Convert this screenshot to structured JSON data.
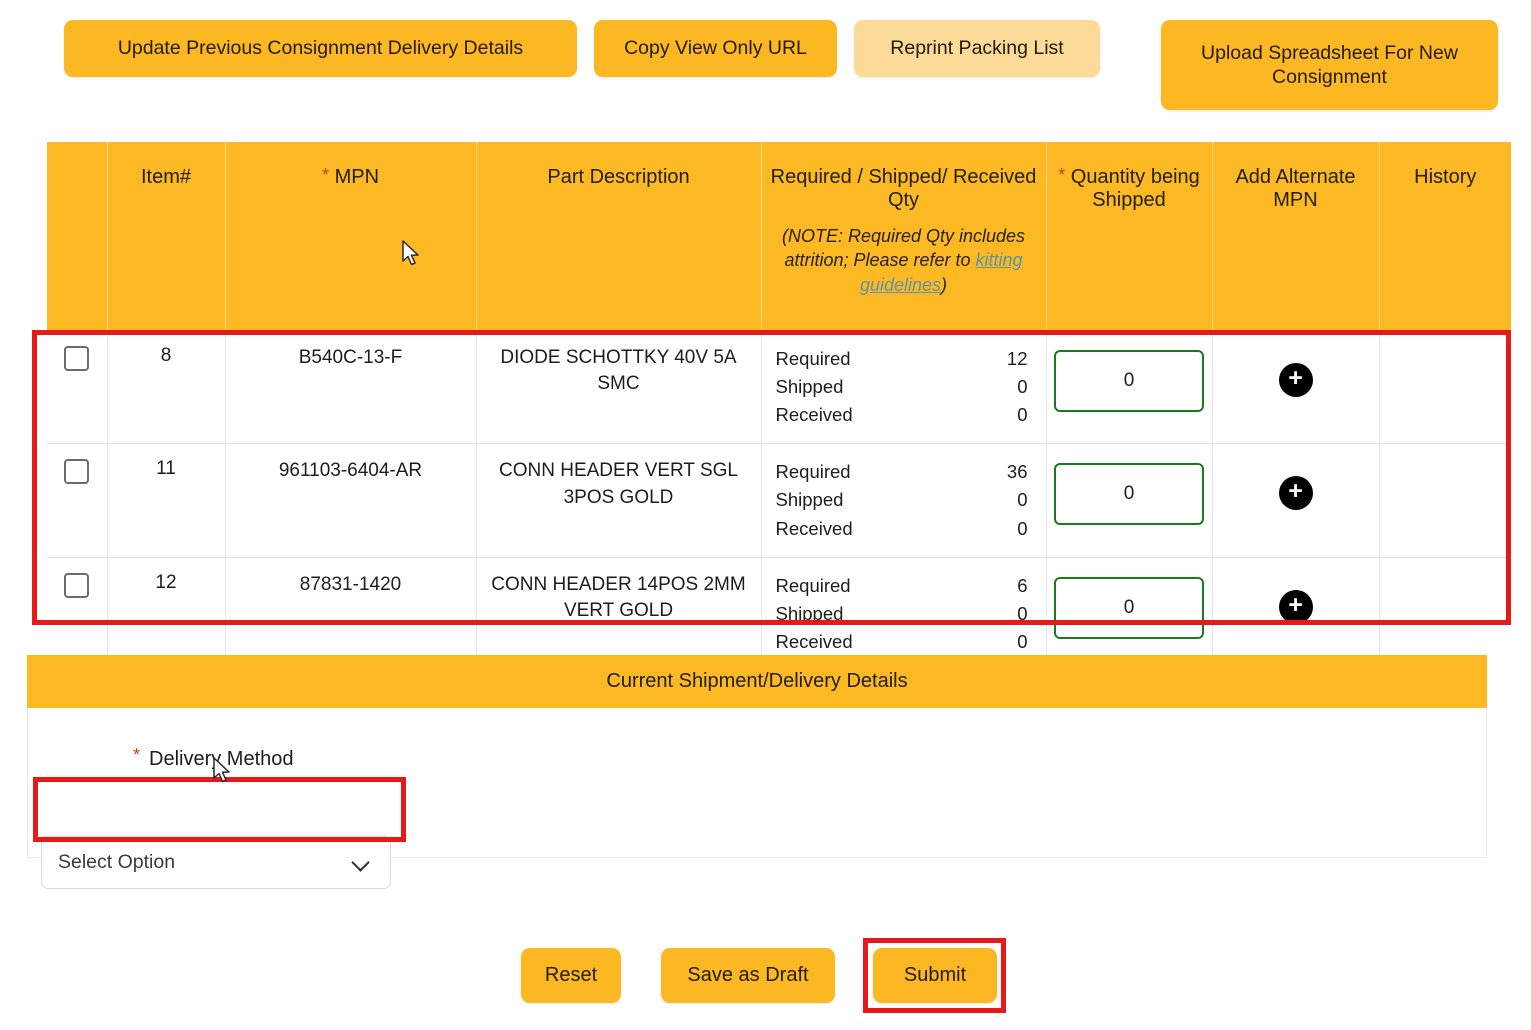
{
  "toolbar": {
    "update_label": "Update Previous Consignment Delivery Details",
    "copy_url_label": "Copy View Only URL",
    "reprint_label": "Reprint Packing List",
    "upload_label": "Upload Spreadsheet For New Consignment"
  },
  "table": {
    "headers": {
      "select": "",
      "item_no": "Item#",
      "mpn": "MPN",
      "mpn_required_marker": "*",
      "part_description": "Part Description",
      "qty_title": "Required / Shipped/ Received Qty",
      "qty_note_prefix": "(NOTE: Required Qty includes attrition; Please refer to ",
      "qty_note_link": "kitting guidelines",
      "qty_note_suffix": ")",
      "quantity_being_shipped": "Quantity being Shipped",
      "quantity_required_marker": "*",
      "add_alternate_mpn": "Add Alternate MPN",
      "history": "History"
    },
    "qty_labels": {
      "required": "Required",
      "shipped": "Shipped",
      "received": "Received"
    },
    "add_icon_label": "+",
    "rows": [
      {
        "item_no": "8",
        "mpn": "B540C-13-F",
        "description": "DIODE SCHOTTKY 40V 5A SMC",
        "required": "12",
        "shipped": "0",
        "received": "0",
        "qty_being_shipped": "0",
        "history": ""
      },
      {
        "item_no": "11",
        "mpn": "961103-6404-AR",
        "description": "CONN HEADER VERT SGL 3POS GOLD",
        "required": "36",
        "shipped": "0",
        "received": "0",
        "qty_being_shipped": "0",
        "history": ""
      },
      {
        "item_no": "12",
        "mpn": "87831-1420",
        "description": "CONN HEADER 14POS 2MM VERT GOLD",
        "required": "6",
        "shipped": "0",
        "received": "0",
        "qty_being_shipped": "0",
        "history": ""
      }
    ]
  },
  "shipment_panel": {
    "title": "Current Shipment/Delivery Details",
    "delivery_method_label": "Delivery Method",
    "delivery_method_required_marker": "*",
    "delivery_method_value": "Select Option"
  },
  "footer": {
    "reset_label": "Reset",
    "save_draft_label": "Save as Draft",
    "submit_label": "Submit"
  },
  "colors": {
    "brand_yellow": "#fcb923",
    "brand_yellow_light": "#fbdb97",
    "annotation_red": "#e81919",
    "input_green": "#1b7a1b",
    "required_star": "#d23b1e",
    "link_teal": "#5f94a5"
  }
}
